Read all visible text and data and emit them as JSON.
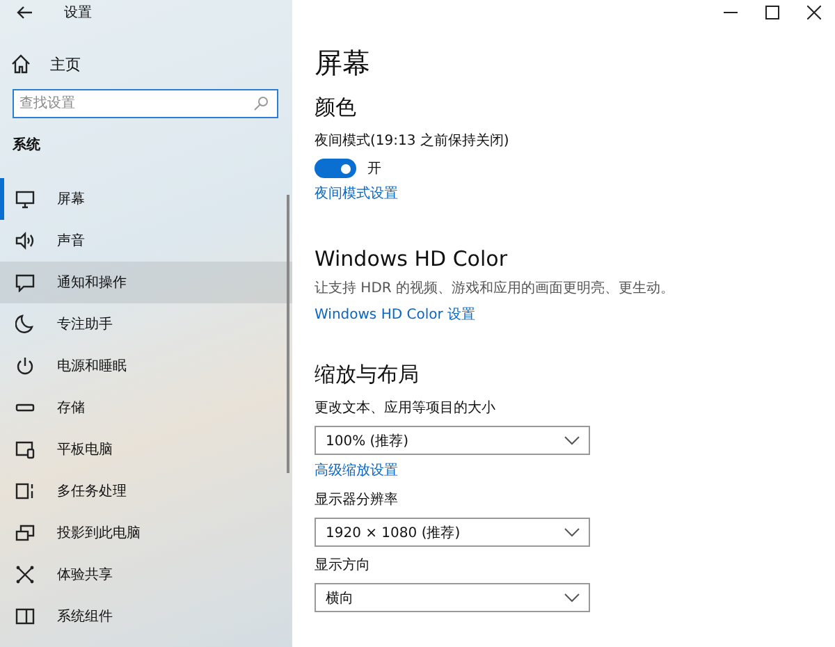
{
  "window": {
    "title": "设置"
  },
  "sidebar": {
    "home": "主页",
    "search": {
      "placeholder": "查找设置"
    },
    "section": "系统",
    "items": [
      {
        "label": "屏幕",
        "selected": true,
        "highlighted": false
      },
      {
        "label": "声音",
        "selected": false,
        "highlighted": false
      },
      {
        "label": "通知和操作",
        "selected": false,
        "highlighted": true
      },
      {
        "label": "专注助手",
        "selected": false,
        "highlighted": false
      },
      {
        "label": "电源和睡眠",
        "selected": false,
        "highlighted": false
      },
      {
        "label": "存储",
        "selected": false,
        "highlighted": false
      },
      {
        "label": "平板电脑",
        "selected": false,
        "highlighted": false
      },
      {
        "label": "多任务处理",
        "selected": false,
        "highlighted": false
      },
      {
        "label": "投影到此电脑",
        "selected": false,
        "highlighted": false
      },
      {
        "label": "体验共享",
        "selected": false,
        "highlighted": false
      },
      {
        "label": "系统组件",
        "selected": false,
        "highlighted": false
      }
    ]
  },
  "content": {
    "title": "屏幕",
    "sections": [
      {
        "heading": "颜色",
        "kind": "heading"
      },
      {
        "kind": "label",
        "text": "夜间模式(19:13 之前保持关闭)"
      },
      {
        "kind": "toggle",
        "on": true,
        "text": "开"
      },
      {
        "kind": "link",
        "text": "夜间模式设置"
      },
      {
        "heading": "Windows HD Color",
        "kind": "heading"
      },
      {
        "kind": "description",
        "text": "让支持 HDR 的视频、游戏和应用的画面更明亮、更生动。"
      },
      {
        "kind": "link",
        "text": "Windows HD Color 设置"
      },
      {
        "heading": "缩放与布局",
        "kind": "heading"
      },
      {
        "kind": "label",
        "text": "更改文本、应用等项目的大小"
      },
      {
        "kind": "dropdown",
        "value": "100% (推荐)"
      },
      {
        "kind": "link",
        "text": "高级缩放设置"
      },
      {
        "kind": "label",
        "text": "显示器分辨率"
      },
      {
        "kind": "dropdown",
        "value": "1920 × 1080 (推荐)"
      },
      {
        "kind": "label",
        "text": "显示方向"
      },
      {
        "kind": "dropdown",
        "value": "横向"
      }
    ]
  }
}
